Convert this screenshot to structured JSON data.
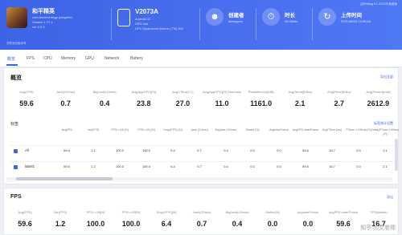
{
  "banner": {
    "game_name": "和平精英",
    "game_lines": [
      "com.tencent.tmgp.pubgmhd",
      "Version 1.17.1",
      "ver 2.0.0"
    ],
    "device_name": "V2073A",
    "device_lines": [
      "Android 11",
      "CPU Info",
      "GPU Qualcomm Adreno (TM) 642"
    ],
    "creator_label": "创建者",
    "creator_value": "liwenyumi",
    "duration_label": "时长",
    "duration_value": "05:28min",
    "upload_label": "上传时间",
    "upload_value": "2021/08/03 13:55:04",
    "note": "关联测试版本号",
    "top_right": "由Perfdog 5.1.210728 免费版"
  },
  "tabs": [
    "概览",
    "FPS",
    "CPU",
    "Memory",
    "GPU",
    "Network",
    "Battery"
  ],
  "overview": {
    "title": "概览",
    "link": "导出全部",
    "metrics": [
      {
        "label": "Avg(FPS)",
        "value": "59.6"
      },
      {
        "label": "Jank(/10min)",
        "value": "0.7"
      },
      {
        "label": "BigJank(/10min)",
        "value": "0.4"
      },
      {
        "label": "Avg(AppCPU)[%]",
        "value": "23.8"
      },
      {
        "label": "AvgCTemp[°C]",
        "value": "27.0"
      },
      {
        "label": "Avg(AppCPU)[%]\nNormalized",
        "value": "11.0"
      },
      {
        "label": "PeakMemory[MB]",
        "value": "1161.0"
      },
      {
        "label": "Avg(Send)[KB/s]",
        "value": "2.1"
      },
      {
        "label": "Avg(Recv)[KB/s]",
        "value": "2.7"
      },
      {
        "label": "Avg(Power)[mW]",
        "value": "2612.9"
      }
    ],
    "subtitle": "标签",
    "sublink": "标签统计设置",
    "columns": [
      "AvgFPS",
      "Var(FPS)",
      "FPS>=18\n[%]",
      "FPS>=25\n[%]",
      "Drop(FPS)\n[/h]",
      "Jank\n(/10min)",
      "BigJank\n(/10min)",
      "Stutter\n[%]",
      "AvgInterFrame",
      "AvgFPS>InterFrame",
      "AvgFTime\n[ms]",
      "FTime>=100ms\n[%]",
      "Delta(FTime>100ms)\n[/h]"
    ],
    "rows": [
      {
        "label": "All",
        "cells": [
          "59.6",
          "1.2",
          "100.0",
          "100.0",
          "6.4",
          "0.7",
          "0.4",
          "0.0",
          "0.0",
          "59.6",
          "16.7",
          "0.0",
          "2.1"
        ]
      },
      {
        "label": "label1",
        "cells": [
          "59.6",
          "1.2",
          "100.0",
          "100.0",
          "6.4",
          "0.7",
          "0.4",
          "0.0",
          "0.0",
          "59.6",
          "16.7",
          "0.0",
          "2.1"
        ]
      }
    ]
  },
  "fps": {
    "title": "FPS",
    "link": "导出",
    "metrics": [
      {
        "label": "Avg(FPS)",
        "value": "59.6"
      },
      {
        "label": "Var(FPS)",
        "value": "1.2"
      },
      {
        "label": "FPS>=18[%]",
        "value": "100.0"
      },
      {
        "label": "FPS>=25[%]",
        "value": "100.0"
      },
      {
        "label": "Drop(FPS)[/h]",
        "value": "6.4"
      },
      {
        "label": "Jank(/10min)",
        "value": "0.7"
      },
      {
        "label": "BigJank(/10min)",
        "value": "0.4"
      },
      {
        "label": "Stutter[%]",
        "value": "0.0"
      },
      {
        "label": "AvgInterFrame",
        "value": "0.0"
      },
      {
        "label": "AvgFPS>InterFrame",
        "value": "59.6"
      },
      {
        "label": "FPS(stable)",
        "value": "16.7"
      }
    ]
  },
  "watermark": "知乎 @文老师"
}
